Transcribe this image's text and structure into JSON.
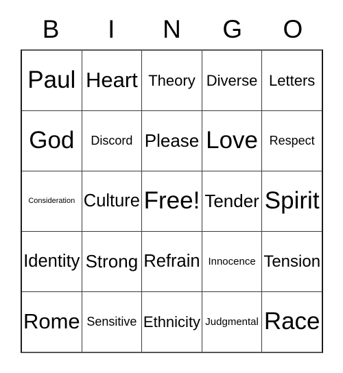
{
  "card": {
    "title": "BINGO",
    "header_letters": [
      "B",
      "I",
      "N",
      "G",
      "O"
    ],
    "free_space_label": "Free!",
    "grid": {
      "columns": 5,
      "rows": 5,
      "border_color": "#3a3a3a",
      "background_color": "#ffffff",
      "text_color": "#000000"
    },
    "cells": [
      [
        {
          "text": "Paul",
          "size": "xl"
        },
        {
          "text": "Heart",
          "size": "lg"
        },
        {
          "text": "Theory",
          "size": "sm"
        },
        {
          "text": "Diverse",
          "size": "sm"
        },
        {
          "text": "Letters",
          "size": "sm"
        }
      ],
      [
        {
          "text": "God",
          "size": "xl"
        },
        {
          "text": "Discord",
          "size": "xs"
        },
        {
          "text": "Please",
          "size": "md"
        },
        {
          "text": "Love",
          "size": "xl"
        },
        {
          "text": "Respect",
          "size": "xs"
        }
      ],
      [
        {
          "text": "Consideration",
          "size": "tiny"
        },
        {
          "text": "Culture",
          "size": "md"
        },
        {
          "text": "Free!",
          "size": "xl"
        },
        {
          "text": "Tender",
          "size": "md"
        },
        {
          "text": "Spirit",
          "size": "xl"
        }
      ],
      [
        {
          "text": "Identity",
          "size": "md"
        },
        {
          "text": "Strong",
          "size": "md"
        },
        {
          "text": "Refrain",
          "size": "md"
        },
        {
          "text": "Innocence",
          "size": "xxs"
        },
        {
          "text": "Tension",
          "size": "md"
        }
      ],
      [
        {
          "text": "Rome",
          "size": "xl"
        },
        {
          "text": "Sensitive",
          "size": "xs"
        },
        {
          "text": "Ethnicity",
          "size": "md"
        },
        {
          "text": "Judgmental",
          "size": "xxs"
        },
        {
          "text": "Race",
          "size": "xl"
        }
      ]
    ]
  }
}
